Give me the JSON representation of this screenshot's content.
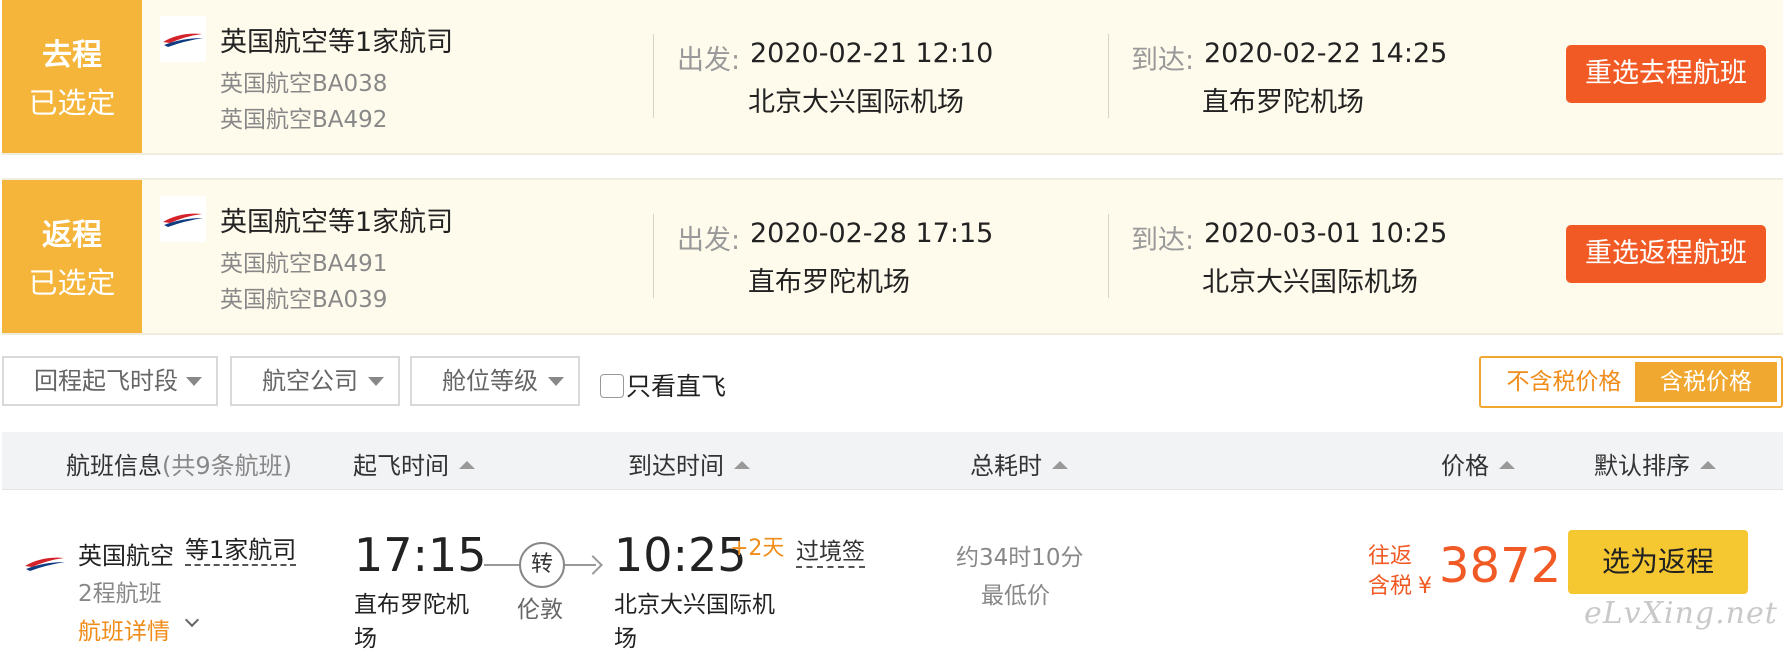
{
  "outbound": {
    "tag_title": "去程",
    "tag_status": "已选定",
    "airline": "英国航空等1家航司",
    "flights": [
      "英国航空BA038",
      "英国航空BA492"
    ],
    "depart_label": "出发:",
    "depart_time": "2020-02-21 12:10",
    "depart_airport": "北京大兴国际机场",
    "arrive_label": "到达:",
    "arrive_time": "2020-02-22 14:25",
    "arrive_airport": "直布罗陀机场",
    "reselect_label": "重选去程航班"
  },
  "return": {
    "tag_title": "返程",
    "tag_status": "已选定",
    "airline": "英国航空等1家航司",
    "flights": [
      "英国航空BA491",
      "英国航空BA039"
    ],
    "depart_label": "出发:",
    "depart_time": "2020-02-28 17:15",
    "depart_airport": "直布罗陀机场",
    "arrive_label": "到达:",
    "arrive_time": "2020-03-01 10:25",
    "arrive_airport": "北京大兴国际机场",
    "reselect_label": "重选返程航班"
  },
  "filters": {
    "time_slot": "回程起飞时段",
    "airline": "航空公司",
    "cabin": "舱位等级",
    "direct_only": "只看直飞",
    "direct_checked": false
  },
  "price_toggle": {
    "without_tax": "不含税价格",
    "with_tax": "含税价格",
    "active": "with_tax"
  },
  "sort_bar": {
    "flight_info": "航班信息",
    "flight_count": "(共9条航班)",
    "depart_time": "起飞时间",
    "arrive_time": "到达时间",
    "duration": "总耗时",
    "price": "价格",
    "default_sort": "默认排序"
  },
  "result": {
    "airline": "英国航空",
    "more_airlines": "等1家航司",
    "legs": "2程航班",
    "detail_link": "航班详情",
    "depart_time": "17:15",
    "depart_airport": "直布罗陀机场",
    "transfer": "转",
    "transfer_city": "伦敦",
    "arrive_time": "10:25",
    "plus_days": "+2天",
    "visa_note": "过境签",
    "arrive_airport": "北京大兴国际机场",
    "duration": "约34时10分",
    "badge": "最低价",
    "price_label_1": "往返",
    "price_label_2": "含税",
    "currency": "¥",
    "price": "3872",
    "select_label": "选为返程"
  },
  "watermark": "eLvXing.net",
  "colors": {
    "tag_bg": "#f4b53a",
    "card_bg": "#fffbec",
    "reselect_btn": "#f15a24",
    "price": "#f15a24",
    "select_btn": "#f5c832",
    "toggle_accent": "#f0a830"
  }
}
